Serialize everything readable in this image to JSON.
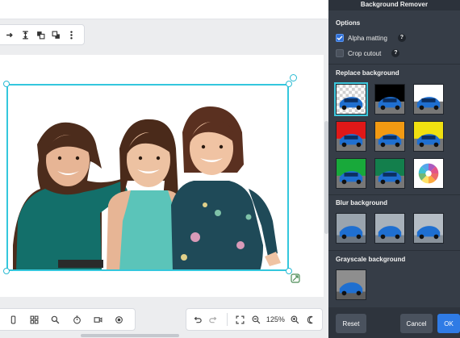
{
  "panel": {
    "title": "Background Remover",
    "options_label": "Options",
    "alpha_matting": {
      "label": "Alpha matting",
      "checked": true,
      "help": "?"
    },
    "crop_cutout": {
      "label": "Crop cutout",
      "checked": false,
      "help": "?"
    },
    "replace_label": "Replace background",
    "blur_label": "Blur background",
    "grayscale_label": "Grayscale background",
    "replace_swatches": [
      {
        "name": "transparent",
        "color": "transparent"
      },
      {
        "name": "black",
        "color": "#000000"
      },
      {
        "name": "white",
        "color": "#ffffff"
      },
      {
        "name": "red",
        "color": "#e01818"
      },
      {
        "name": "orange",
        "color": "#f29a12"
      },
      {
        "name": "yellow",
        "color": "#f0e010"
      },
      {
        "name": "green",
        "color": "#18a93a"
      },
      {
        "name": "teal",
        "color": "#137f4c"
      },
      {
        "name": "color-picker",
        "color": "#ffffff"
      }
    ],
    "buttons": {
      "reset": "Reset",
      "cancel": "Cancel",
      "ok": "OK"
    }
  },
  "zoom": "125%",
  "colors": {
    "accent": "#34c7dd",
    "panel_bg": "#363d47",
    "primary": "#2f7be5"
  }
}
